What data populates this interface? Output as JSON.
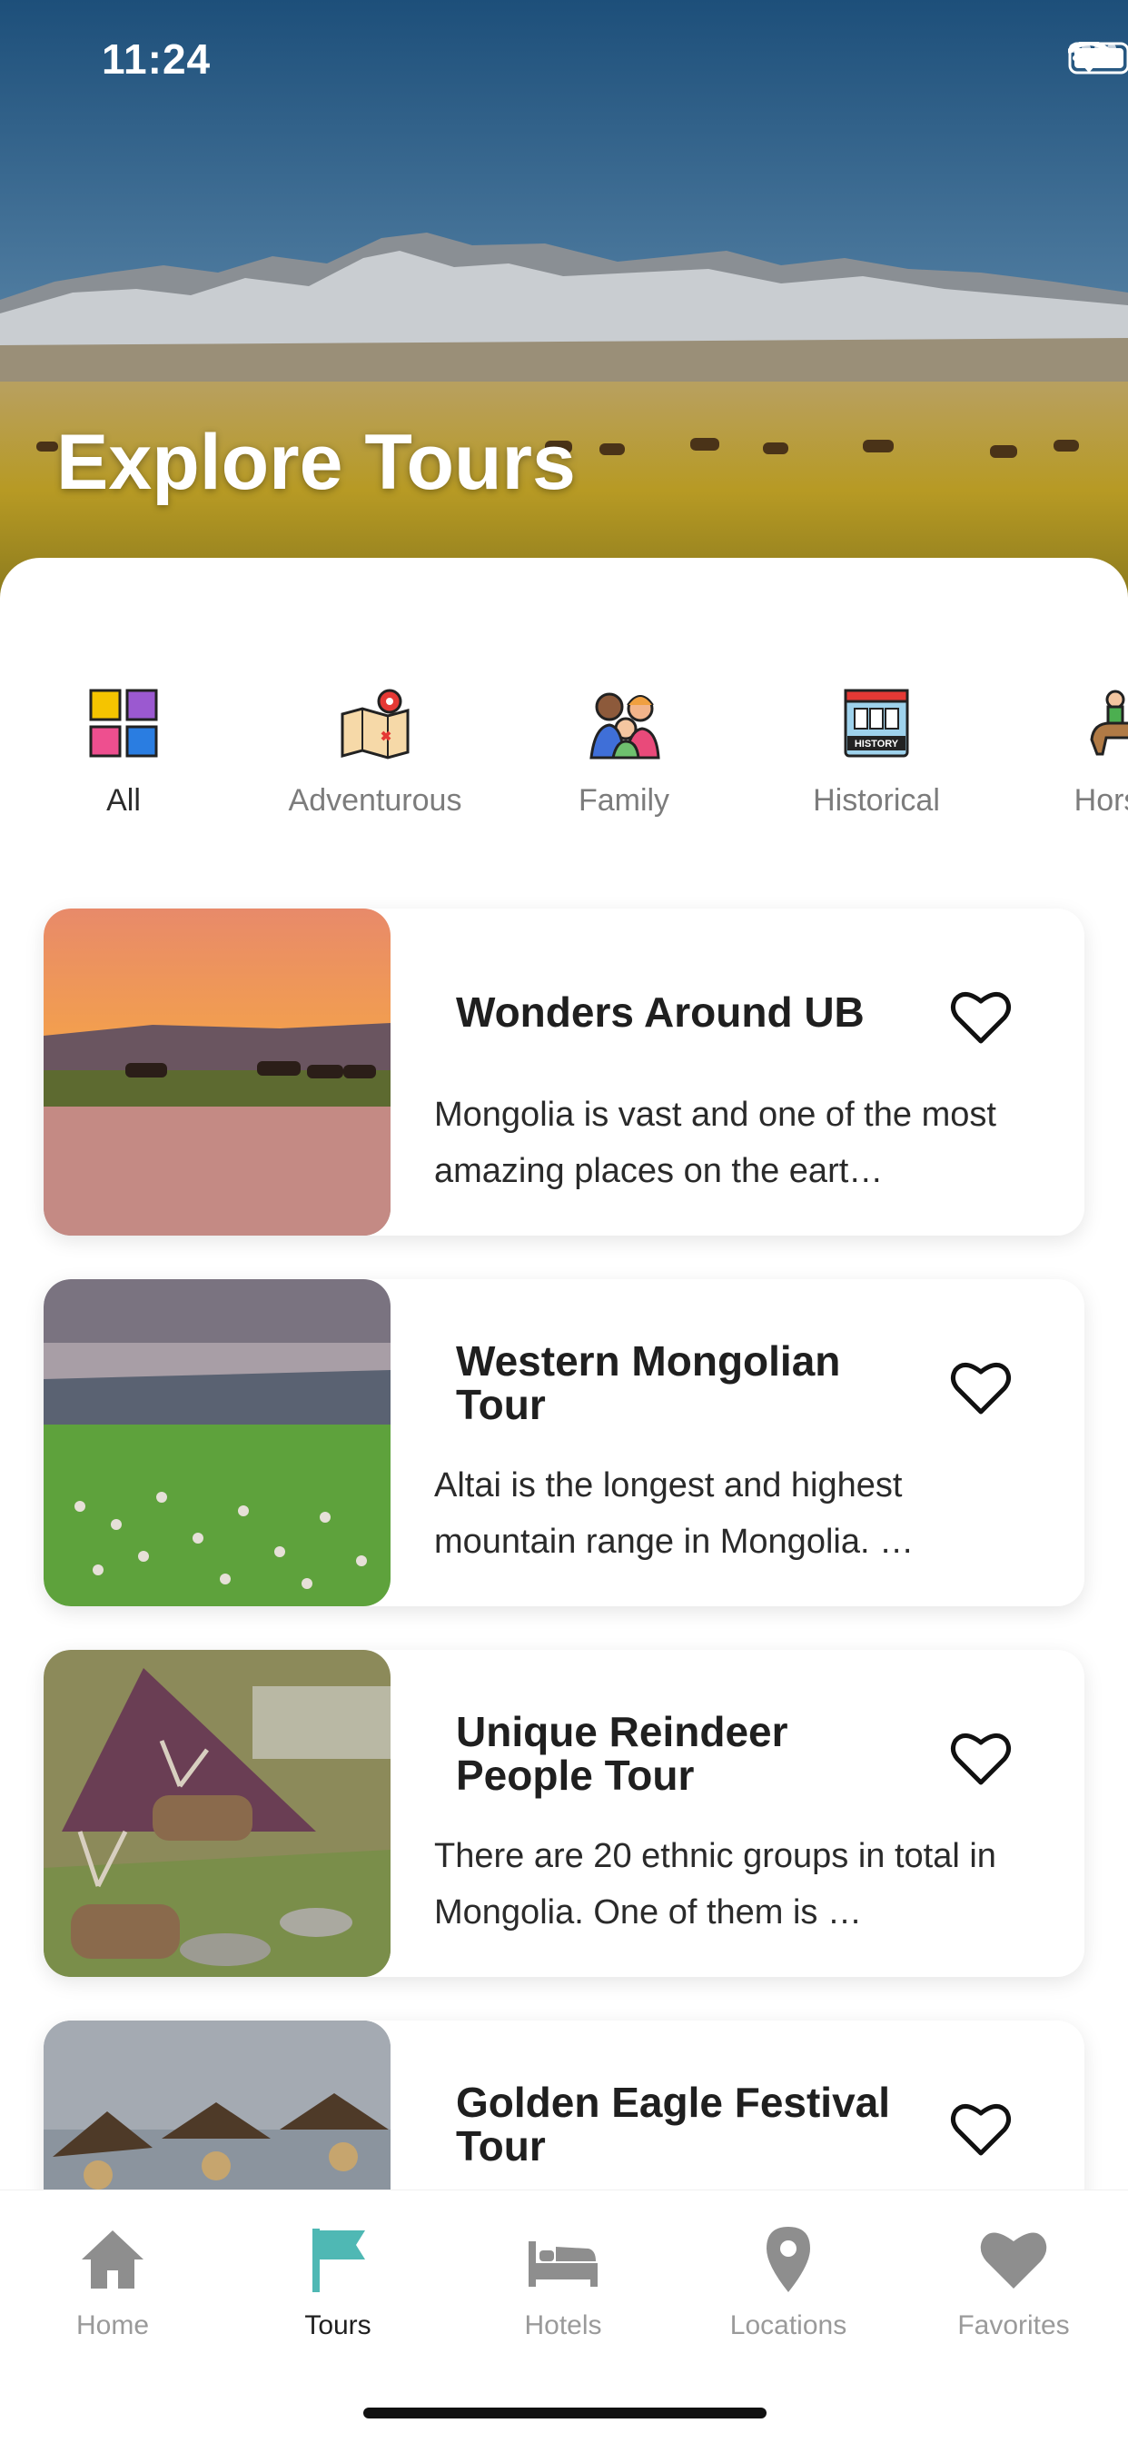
{
  "status_bar": {
    "time": "11:24"
  },
  "hero": {
    "title": "Explore Tours"
  },
  "categories": [
    {
      "label": "All",
      "icon": "grid-icon",
      "active": true
    },
    {
      "label": "Adventurous",
      "icon": "treasure-map-icon",
      "active": false
    },
    {
      "label": "Family",
      "icon": "family-icon",
      "active": false
    },
    {
      "label": "Historical",
      "icon": "history-building-icon",
      "active": false
    },
    {
      "label": "Horse",
      "icon": "horse-rider-icon",
      "active": false
    }
  ],
  "tours": [
    {
      "title": "Wonders Around UB",
      "description": "Mongolia is vast and one of the most amazing places on the eart…",
      "favorite": false
    },
    {
      "title": "Western Mongolian Tour",
      "description": "Altai is the longest and highest mountain range in Mongolia. …",
      "favorite": false
    },
    {
      "title": "Unique Reindeer People Tour",
      "description": "There are 20 ethnic groups in total in Mongolia. One of them is …",
      "favorite": false
    },
    {
      "title": "Golden Eagle Festival Tour",
      "description": "",
      "favorite": false
    }
  ],
  "tabs": [
    {
      "label": "Home",
      "icon": "home-icon",
      "active": false
    },
    {
      "label": "Tours",
      "icon": "flag-icon",
      "active": true
    },
    {
      "label": "Hotels",
      "icon": "bed-icon",
      "active": false
    },
    {
      "label": "Locations",
      "icon": "location-pin-icon",
      "active": false
    },
    {
      "label": "Favorites",
      "icon": "heart-icon",
      "active": false
    }
  ],
  "colors": {
    "accent": "#4fb8b4",
    "tab_inactive": "#9a9a9a",
    "category_underline": "#67b6e6"
  }
}
